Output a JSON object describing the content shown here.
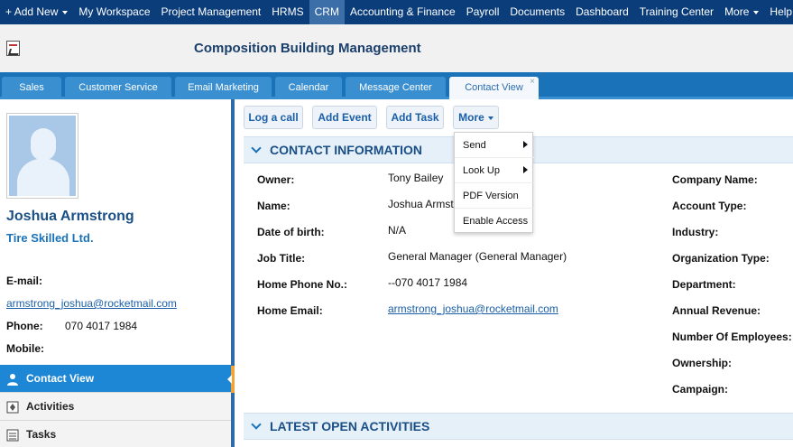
{
  "topnav": {
    "add_new": "Add New",
    "items": [
      "My Workspace",
      "Project Management",
      "HRMS",
      "CRM",
      "Accounting & Finance",
      "Payroll",
      "Documents",
      "Dashboard",
      "Training Center",
      "More",
      "Help"
    ],
    "active": "CRM"
  },
  "header": {
    "title": "Composition Building Management"
  },
  "tabs": [
    {
      "label": "Sales"
    },
    {
      "label": "Customer Service"
    },
    {
      "label": "Email Marketing"
    },
    {
      "label": "Calendar"
    },
    {
      "label": "Message Center"
    },
    {
      "label": "Contact View",
      "active": true,
      "close": "×"
    }
  ],
  "contact": {
    "name": "Joshua Armstrong",
    "company": "Tire Skilled Ltd.",
    "email_label": "E-mail:",
    "email": "armstrong_joshua@rocketmail.com",
    "phone_label": "Phone:",
    "phone": "070 4017 1984",
    "mobile_label": "Mobile:"
  },
  "leftnav": [
    {
      "label": "Contact View",
      "icon": "person-icon",
      "active": true
    },
    {
      "label": "Activities",
      "icon": "activities-icon"
    },
    {
      "label": "Tasks",
      "icon": "tasks-icon"
    }
  ],
  "toolbar": {
    "log_call": "Log a call",
    "add_event": "Add Event",
    "add_task": "Add Task",
    "more": "More"
  },
  "dropdown": {
    "items": [
      {
        "label": "Send",
        "submenu": true
      },
      {
        "label": "Look Up",
        "submenu": true
      },
      {
        "label": "PDF Version"
      },
      {
        "label": "Enable Access"
      }
    ]
  },
  "contact_info": {
    "title": "CONTACT INFORMATION",
    "left_fields": [
      {
        "label": "Owner:",
        "value": "Tony Bailey"
      },
      {
        "label": "Name:",
        "value": "Joshua Armst"
      },
      {
        "label": "Date of birth:",
        "value": "N/A"
      },
      {
        "label": "Job Title:",
        "value": "General Manager (General Manager)"
      },
      {
        "label": "Home Phone No.:",
        "value": "--070 4017 1984"
      },
      {
        "label": "Home Email:",
        "value": "armstrong_joshua@rocketmail.com"
      }
    ],
    "right_labels": [
      "Company Name:",
      "Account Type:",
      "Industry:",
      "Organization Type:",
      "Department:",
      "Annual Revenue:",
      "Number Of Employees:",
      "Ownership:",
      "Campaign:"
    ]
  },
  "activities": {
    "title": "LATEST OPEN ACTIVITIES"
  },
  "colors": {
    "topnav_bg": "#0a3d7a",
    "tabbar_bg": "#1a73b8",
    "accent": "#1d87d6",
    "link": "#1a5fa8"
  }
}
